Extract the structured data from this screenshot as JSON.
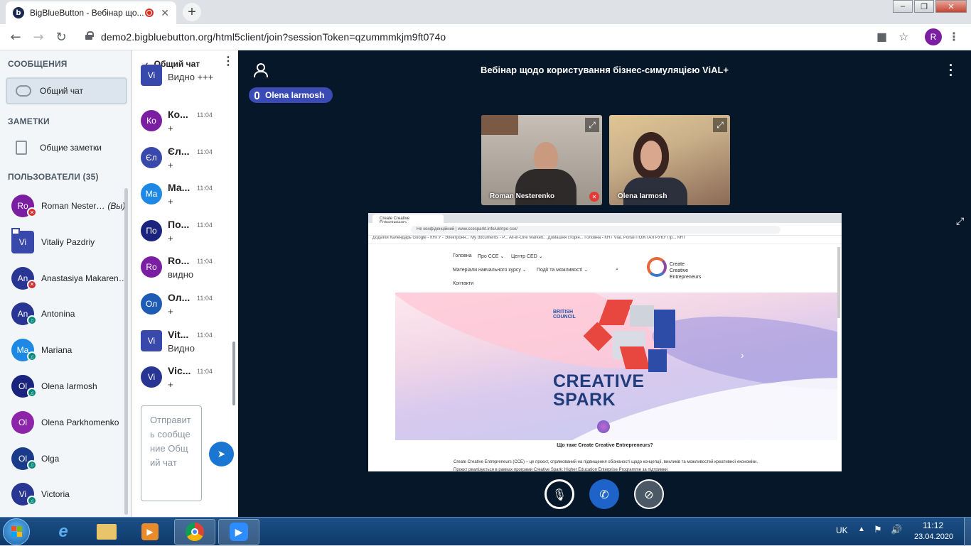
{
  "browser": {
    "tab_title": "BigBlueButton - Вебінар що...",
    "tab_favicon": "b",
    "url": "demo2.bigbluebutton.org/html5client/join?sessionToken=qzummmkjm9ft074o",
    "profile_initial": "R",
    "new_tab": "+",
    "close_tab": "✕"
  },
  "sidebar": {
    "messages_header": "СООБЩЕНИЯ",
    "public_chat": "Общий чат",
    "notes_header": "ЗАМЕТКИ",
    "shared_notes": "Общие заметки",
    "users_header": "ПОЛЬЗОВАТЕЛИ (35)",
    "users": [
      {
        "initials": "Ro",
        "name": "Roman Nester…",
        "you": "(Вы)",
        "color": "#7b1fa2",
        "shape": "round",
        "status": "muted"
      },
      {
        "initials": "Vi",
        "name": "Vitaliy Pazdriy",
        "color": "#3949ab",
        "shape": "sq",
        "status": "none"
      },
      {
        "initials": "An",
        "name": "Anastasiya Makaren…",
        "color": "#283593",
        "shape": "round",
        "status": "muted"
      },
      {
        "initials": "An",
        "name": "Antonina",
        "color": "#283593",
        "shape": "round",
        "status": "listen"
      },
      {
        "initials": "Ma",
        "name": "Mariana",
        "color": "#1e88e5",
        "shape": "round",
        "status": "listen"
      },
      {
        "initials": "Ol",
        "name": "Olena Iarmosh",
        "color": "#1a237e",
        "shape": "round",
        "status": "listen"
      },
      {
        "initials": "Ol",
        "name": "Olena Parkhomenko",
        "color": "#8e24aa",
        "shape": "round",
        "status": "none"
      },
      {
        "initials": "Ol",
        "name": "Olga",
        "color": "#1a3a8a",
        "shape": "round",
        "status": "listen"
      },
      {
        "initials": "Vi",
        "name": "Victoria",
        "color": "#283593",
        "shape": "round",
        "status": "listen"
      }
    ]
  },
  "chat": {
    "title": "Общий чат",
    "messages": [
      {
        "initials": "Vi",
        "name": "",
        "time": "",
        "text": "Видно +++",
        "color": "#3949ab",
        "shape": "sq"
      },
      {
        "initials": "Ко",
        "name": "Ко...",
        "time": "11:04",
        "text": "+",
        "color": "#7b1fa2",
        "shape": "round"
      },
      {
        "initials": "Єл",
        "name": "Єл...",
        "time": "11:04",
        "text": "+",
        "color": "#3949ab",
        "shape": "round"
      },
      {
        "initials": "Ма",
        "name": "Ма...",
        "time": "11:04",
        "text": "+",
        "color": "#1e88e5",
        "shape": "round"
      },
      {
        "initials": "По",
        "name": "По...",
        "time": "11:04",
        "text": "+",
        "color": "#1a237e",
        "shape": "round"
      },
      {
        "initials": "Ro",
        "name": "Ro...",
        "time": "11:04",
        "text": "видно",
        "color": "#7b1fa2",
        "shape": "round"
      },
      {
        "initials": "Ол",
        "name": "Ол...",
        "time": "11:04",
        "text": "+",
        "color": "#1e5bb5",
        "shape": "round"
      },
      {
        "initials": "Vi",
        "name": "Vit...",
        "time": "11:04",
        "text": "Видно",
        "color": "#3949ab",
        "shape": "sq"
      },
      {
        "initials": "Vi",
        "name": "Vic...",
        "time": "11:04",
        "text": "+",
        "color": "#283593",
        "shape": "round"
      }
    ],
    "input_placeholder": "Отправить сообщение Общий чат"
  },
  "meeting": {
    "title": "Вебінар щодо користування бізнес-симуляцією ViAL+",
    "talking": "Olena Iarmosh",
    "videos": [
      {
        "name": "Roman Nesterenko"
      },
      {
        "name": "Olena Iarmosh"
      }
    ]
  },
  "shared_screen": {
    "tab_title": "Create Creative Entrepreneurs",
    "address": "Не конфіденційний  |  www.ccesparkt.info/uk/про-cce/",
    "bookmarks": "Додатки    Календарь Google -    КНТУ - Электронн...    My documents - P...    All-in-One Marketi...    Домашня сторін...    Головна - КНТ    ViaL Portal    ПОЖТАЛ РУКУ Пр...    КНТ",
    "nav": [
      "Головна",
      "Про CCE ⌄",
      "Центр CED ⌄",
      "Матеріали навчального курсу ⌄",
      "Події та можливості ⌄",
      "Контакти"
    ],
    "logo_text": [
      "Create",
      "Creative",
      "Entrepreneurs"
    ],
    "british_council": [
      "BRITISH",
      "COUNCIL"
    ],
    "headline": [
      "CREATIVE",
      "SPARK"
    ],
    "question": "Що таке Create Creative Entrepreneurs?",
    "paragraph": "Create Creative Entrepreneurs (CCE) – це проєкт, спрямований на підвищення обізнаності щодо концепції, викликів та можливостей креативної економіки. Проєкт реалізується в рамках програми Creative Spark: Higher Education Enterprise Programme за підтримки"
  },
  "taskbar": {
    "lang": "UK",
    "time": "11:12",
    "date": "23.04.2020"
  }
}
